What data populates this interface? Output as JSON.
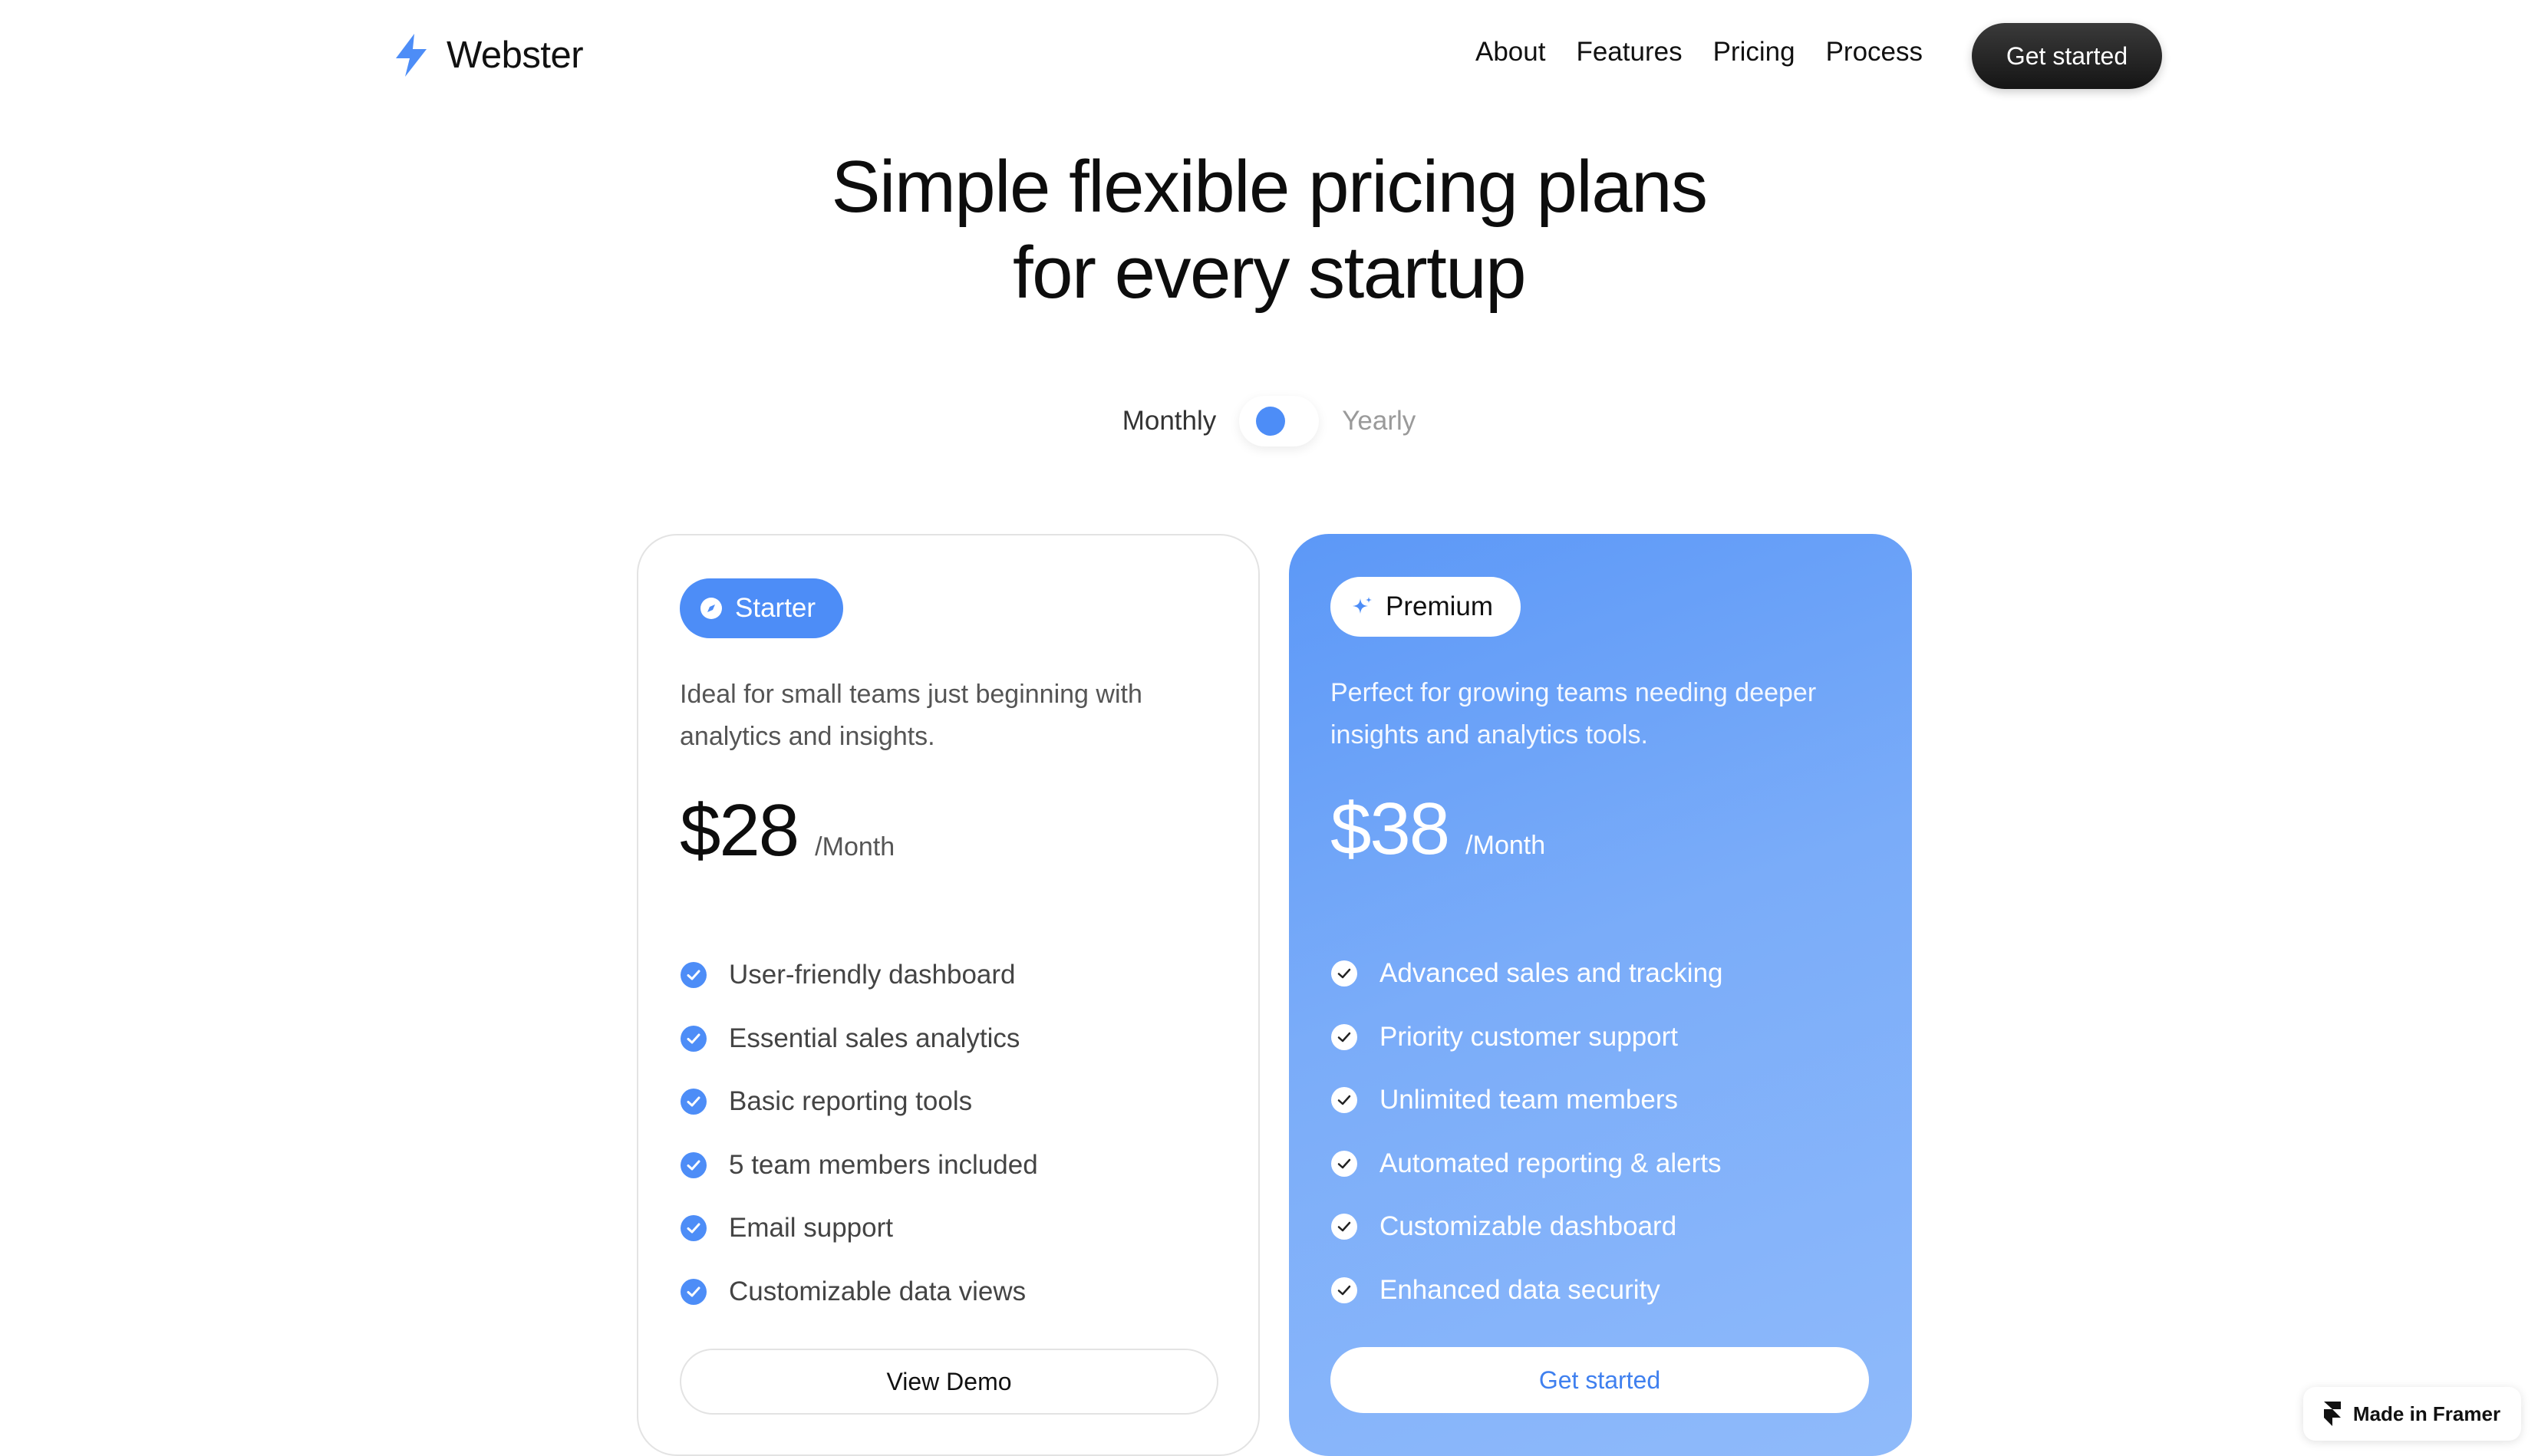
{
  "brand": {
    "name": "Webster",
    "accent": "#4d8df7"
  },
  "nav": {
    "items": [
      "About",
      "Features",
      "Pricing",
      "Process"
    ],
    "cta": "Get started"
  },
  "hero": {
    "line1": "Simple flexible pricing plans",
    "line2": "for every startup"
  },
  "billing": {
    "monthly": "Monthly",
    "yearly": "Yearly",
    "selected": "Monthly"
  },
  "plans": [
    {
      "badge": "Starter",
      "description": "Ideal for small teams just beginning with analytics and insights.",
      "price": "$28",
      "period": "/Month",
      "features": [
        "User-friendly dashboard",
        "Essential sales analytics",
        "Basic reporting tools",
        "5 team members included",
        "Email support",
        "Customizable data views"
      ],
      "cta": "View Demo"
    },
    {
      "badge": "Premium",
      "description": "Perfect for growing teams needing deeper insights and analytics tools.",
      "price": "$38",
      "period": "/Month",
      "features": [
        "Advanced sales and tracking",
        "Priority customer support",
        "Unlimited team members",
        "Automated reporting & alerts",
        "Customizable dashboard",
        "Enhanced data security"
      ],
      "cta": "Get started"
    }
  ],
  "footer_badge": {
    "label": "Made in Framer"
  }
}
